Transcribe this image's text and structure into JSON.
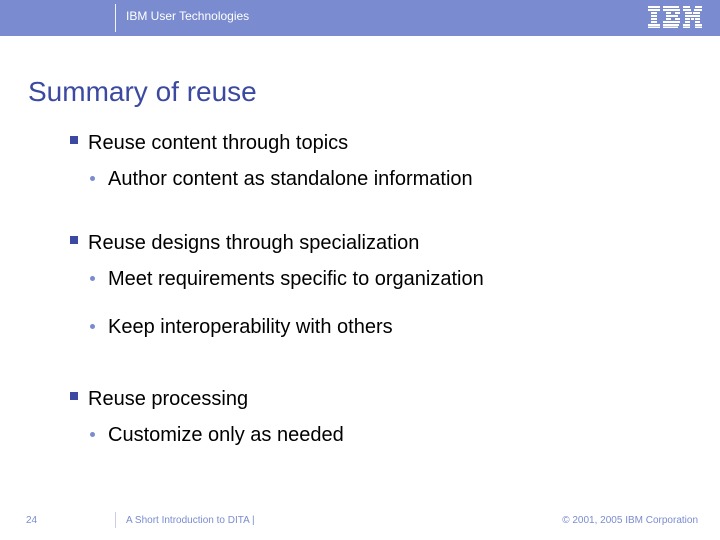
{
  "header": {
    "org": "IBM User Technologies",
    "logo_alt": "IBM"
  },
  "title": "Summary of reuse",
  "content": {
    "b1": "Reuse content through topics",
    "b1a": "Author content as standalone information",
    "b2": "Reuse designs through specialization",
    "b2a": "Meet requirements specific to organization",
    "b2b": "Keep interoperability with others",
    "b3": "Reuse processing",
    "b3a": "Customize only as needed"
  },
  "footer": {
    "page": "24",
    "deck_title": "A Short Introduction to DITA |",
    "copyright": "© 2001, 2005 IBM Corporation"
  },
  "colors": {
    "header_bg": "#7a8ccf",
    "accent": "#3b4aa0"
  }
}
